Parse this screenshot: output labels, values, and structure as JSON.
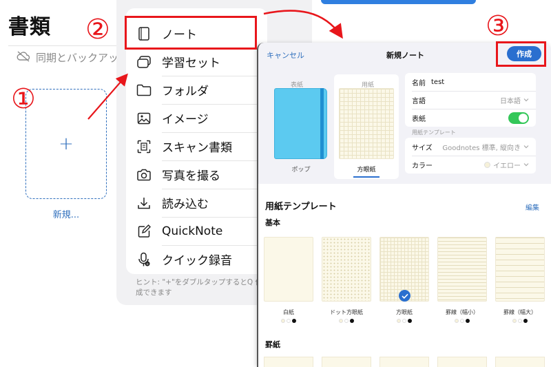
{
  "documents": {
    "title": "書類",
    "sync_text": "同期とバックアップ",
    "new_label": "新規..."
  },
  "menu": {
    "items": [
      {
        "label": "ノート",
        "icon": "notebook-icon"
      },
      {
        "label": "学習セット",
        "icon": "flashcards-icon"
      },
      {
        "label": "フォルダ",
        "icon": "folder-icon"
      },
      {
        "label": "イメージ",
        "icon": "image-icon"
      },
      {
        "label": "スキャン書類",
        "icon": "scan-icon"
      },
      {
        "label": "写真を撮る",
        "icon": "camera-icon"
      },
      {
        "label": "読み込む",
        "icon": "import-icon"
      },
      {
        "label": "QuickNote",
        "icon": "quicknote-icon"
      },
      {
        "label": "クイック録音",
        "icon": "microphone-icon"
      }
    ],
    "hint": "ヒント: \"+\"をダブルタップするとQ 作成できます"
  },
  "new_note": {
    "cancel_label": "キャンセル",
    "title": "新規ノート",
    "create_label": "作成",
    "cover_tab": "表紙",
    "paper_tab": "用紙",
    "cover_name": "ポップ",
    "paper_name": "方眼紙",
    "fields": {
      "name_label": "名前",
      "name_value": "test",
      "language_label": "言語",
      "language_value": "日本語",
      "cover_label": "表紙",
      "cover_enabled": true,
      "template_section": "用紙テンプレート",
      "size_label": "サイズ",
      "size_value": "Goodnotes 標準, 縦向き",
      "color_label": "カラー",
      "color_value": "イエロー"
    },
    "templates_heading": "用紙テンプレート",
    "edit_label": "編集",
    "basic_heading": "基本",
    "templates": [
      {
        "name": "白紙"
      },
      {
        "name": "ドット方眼紙"
      },
      {
        "name": "方眼紙",
        "selected": true
      },
      {
        "name": "罫線（幅小）"
      },
      {
        "name": "罫線（幅大）"
      }
    ],
    "ruled_heading": "罫紙"
  },
  "annotations": {
    "step1": "①",
    "step2": "②",
    "step3": "③"
  },
  "colors": {
    "accent": "#2a6fcf",
    "annotation_red": "#e8161b",
    "toggle_green": "#34c759",
    "cover_blue": "#5ccaf0"
  }
}
